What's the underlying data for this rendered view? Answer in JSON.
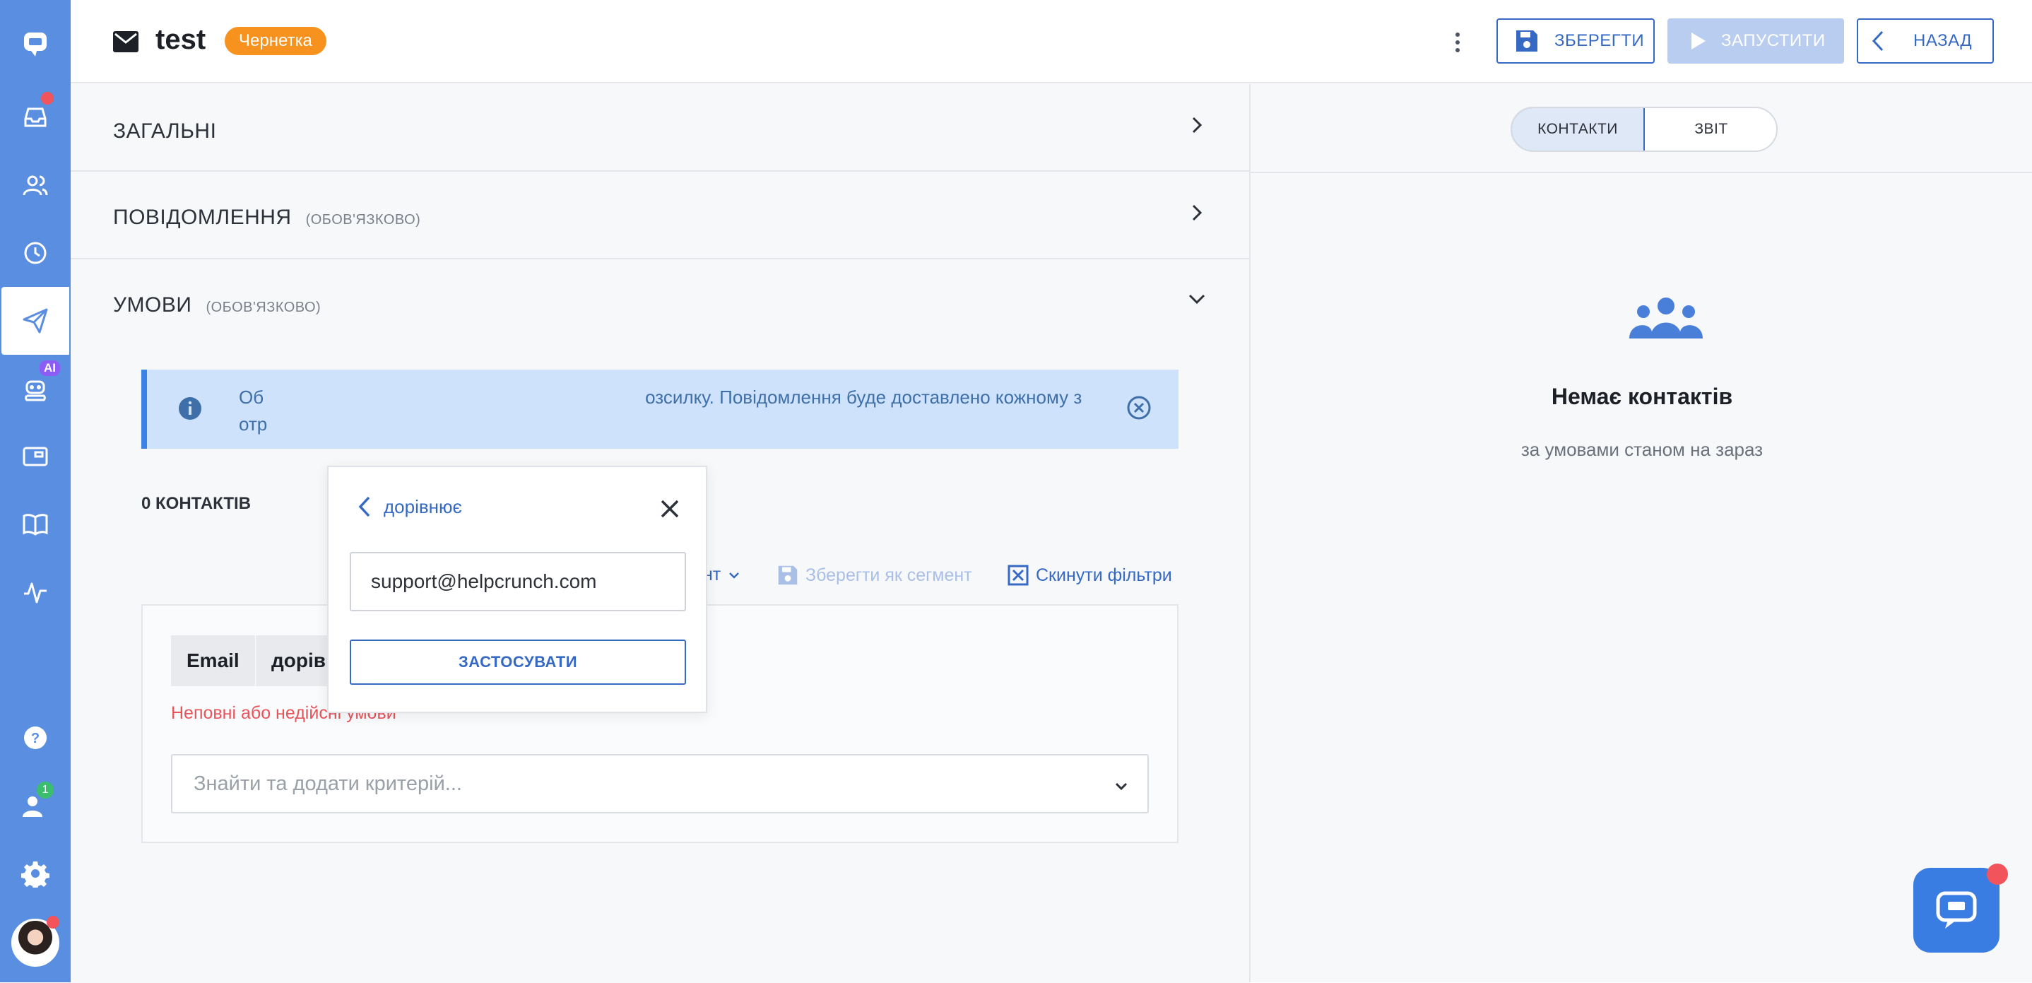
{
  "sidebar": {
    "items": [
      {
        "name": "chat-logo-icon"
      },
      {
        "name": "inbox-icon"
      },
      {
        "name": "contacts-icon"
      },
      {
        "name": "history-icon"
      },
      {
        "name": "campaigns-icon"
      },
      {
        "name": "ai-bot-icon",
        "badge": "AI"
      },
      {
        "name": "widget-icon"
      },
      {
        "name": "knowledge-base-icon"
      },
      {
        "name": "activity-icon"
      },
      {
        "name": "help-icon"
      },
      {
        "name": "team-icon",
        "badge": "1"
      },
      {
        "name": "settings-icon"
      }
    ]
  },
  "header": {
    "title": "test",
    "status": "Чернетка",
    "save_label": "ЗБЕРЕГТИ",
    "run_label": "ЗАПУСТИТИ",
    "back_label": "НАЗАД"
  },
  "sections": {
    "general": {
      "label": "ЗАГАЛЬНІ"
    },
    "message": {
      "label": "ПОВІДОМЛЕННЯ",
      "sub": "(ОБОВ'ЯЗКОВО)"
    },
    "conditions": {
      "label": "УМОВИ",
      "sub": "(ОБОВ'ЯЗКОВО)"
    }
  },
  "info_bar": {
    "text_start": "Об",
    "text_end": "озсилку. Повідомлення буде доставлено кожному з",
    "text_line2": "отр"
  },
  "contacts_count": "0 КОНТАКТІВ",
  "segment_actions": {
    "load": "ти сегмент",
    "save": "Зберегти як сегмент",
    "reset": "Скинути фільтри"
  },
  "filter": {
    "field": "Email",
    "operator": "дорівнює",
    "error": "Неповні або недійсні умови",
    "search_placeholder": "Знайти та додати критерій..."
  },
  "popover": {
    "back_label": "дорівнює",
    "input_value": "support@helpcrunch.com",
    "apply_label": "ЗАСТОСУВАТИ"
  },
  "right_panel": {
    "tabs": [
      "КОНТАКТИ",
      "ЗВІТ"
    ],
    "active_tab": "КОНТАКТИ",
    "empty_title": "Немає контактів",
    "empty_sub": "за умовами станом на зараз"
  },
  "colors": {
    "sidebar": "#5a8ee0",
    "accent": "#3569c4",
    "draft_badge": "#f7921e",
    "error": "#e8545a",
    "info_bg": "#cfe2fb"
  }
}
